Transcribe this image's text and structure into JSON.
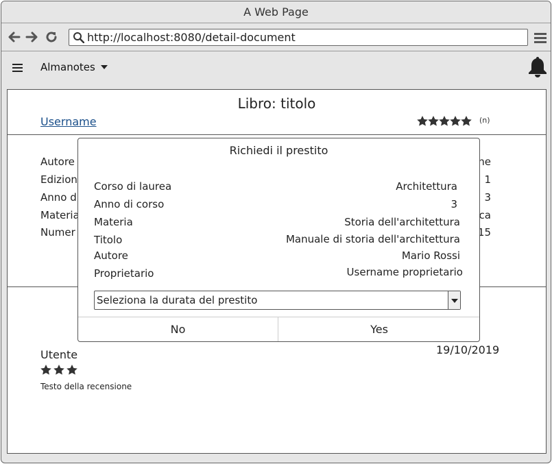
{
  "browser": {
    "window_title": "A Web Page",
    "url": "http://localhost:8080/detail-document"
  },
  "app": {
    "name": "Almanotes"
  },
  "document": {
    "title": "Libro: titolo",
    "owner_link": "Username",
    "rating_count": "(n)",
    "rating_stars": 5,
    "fields": [
      {
        "label": "Autore",
        "value": "ne"
      },
      {
        "label": "Edizion",
        "value": "1"
      },
      {
        "label": "Anno d",
        "value": "3"
      },
      {
        "label": "Materia",
        "value": "ca"
      },
      {
        "label": "Numer",
        "value": "15"
      }
    ]
  },
  "review": {
    "user": "Utente",
    "date": "19/10/2019",
    "stars": 3,
    "text": "Testo della recensione"
  },
  "dialog": {
    "title": "Richiedi il prestito",
    "rows": [
      {
        "label": "Corso di laurea",
        "value": "Architettura"
      },
      {
        "label": "Anno di corso",
        "value": "3"
      },
      {
        "label": "Materia",
        "value": "Storia dell'architettura"
      },
      {
        "label": "Titolo",
        "value": "Manuale di storia dell'architettura"
      },
      {
        "label": "Autore",
        "value": "Mario Rossi"
      },
      {
        "label": "Proprietario",
        "value": "Username proprietario"
      }
    ],
    "select_placeholder": "Seleziona la durata del prestito",
    "no_label": "No",
    "yes_label": "Yes"
  }
}
